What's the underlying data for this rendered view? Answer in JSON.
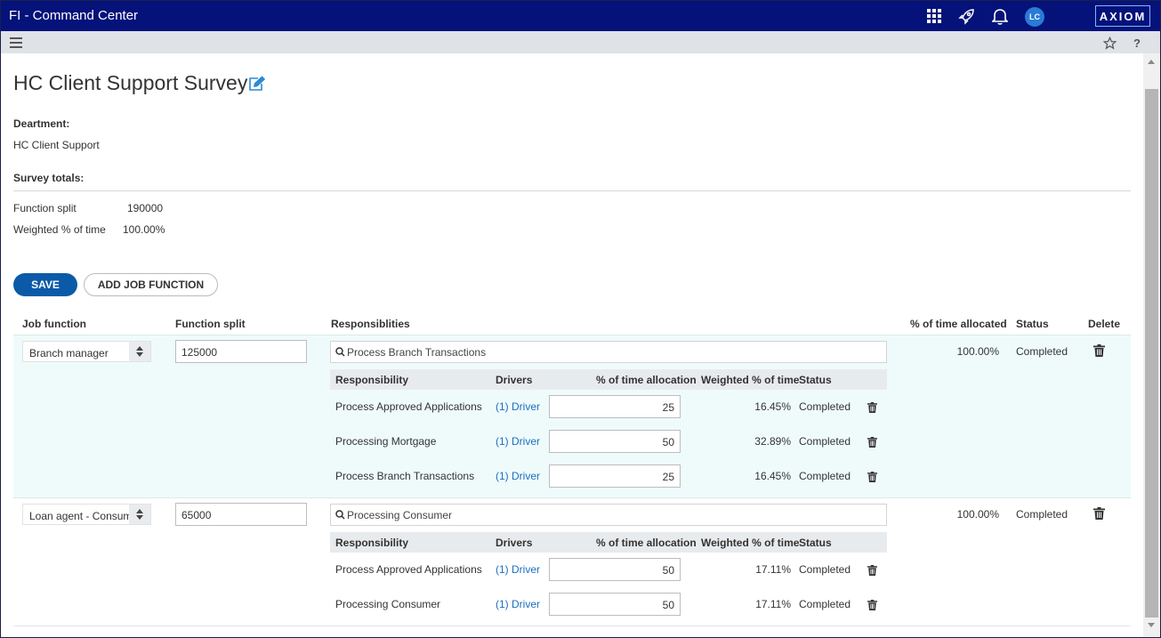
{
  "app": {
    "title": "FI - Command Center",
    "avatar_initials": "LC",
    "logo_text": "AXIOM"
  },
  "icons": {
    "menu": "hamburger-icon",
    "apps": "apps-grid-icon",
    "launch": "rocket-icon",
    "notifications": "bell-icon",
    "favorite": "star-icon",
    "help": "help-icon",
    "edit": "edit-icon",
    "search": "search-icon",
    "delete": "trash-icon"
  },
  "page": {
    "title": "HC Client Support Survey",
    "department_label": "Deartment:",
    "department_value": "HC Client Support",
    "totals_label": "Survey totals:",
    "function_split_label": "Function split",
    "function_split_value": "190000",
    "weighted_label": "Weighted % of time",
    "weighted_value": "100.00%"
  },
  "actions": {
    "save": "SAVE",
    "add_job_function": "ADD JOB FUNCTION"
  },
  "columns": {
    "job_function": "Job function",
    "function_split": "Function split",
    "responsibilities": "Responsiblities",
    "pct_allocated": "% of time allocated",
    "status": "Status",
    "delete": "Delete"
  },
  "sub_columns": {
    "responsibility": "Responsibility",
    "drivers": "Drivers",
    "pct_allocation": "% of time allocation",
    "weighted": "Weighted % of time",
    "status": "Status"
  },
  "job_functions": [
    {
      "job_function": "Branch manager",
      "function_split": "125000",
      "search_value": "Process Branch Transactions",
      "pct_allocated": "100.00%",
      "status": "Completed",
      "responsibilities": [
        {
          "name": "Process Approved Applications",
          "driver": "(1) Driver",
          "allocation": "25",
          "weighted": "16.45%",
          "status": "Completed"
        },
        {
          "name": "Processing Mortgage",
          "driver": "(1) Driver",
          "allocation": "50",
          "weighted": "32.89%",
          "status": "Completed"
        },
        {
          "name": "Process Branch Transactions",
          "driver": "(1) Driver",
          "allocation": "25",
          "weighted": "16.45%",
          "status": "Completed"
        }
      ]
    },
    {
      "job_function": "Loan agent - Consumer",
      "function_split": "65000",
      "search_value": "Processing Consumer",
      "pct_allocated": "100.00%",
      "status": "Completed",
      "responsibilities": [
        {
          "name": "Process Approved Applications",
          "driver": "(1) Driver",
          "allocation": "50",
          "weighted": "17.11%",
          "status": "Completed"
        },
        {
          "name": "Processing Consumer",
          "driver": "(1) Driver",
          "allocation": "50",
          "weighted": "17.11%",
          "status": "Completed"
        }
      ]
    }
  ]
}
